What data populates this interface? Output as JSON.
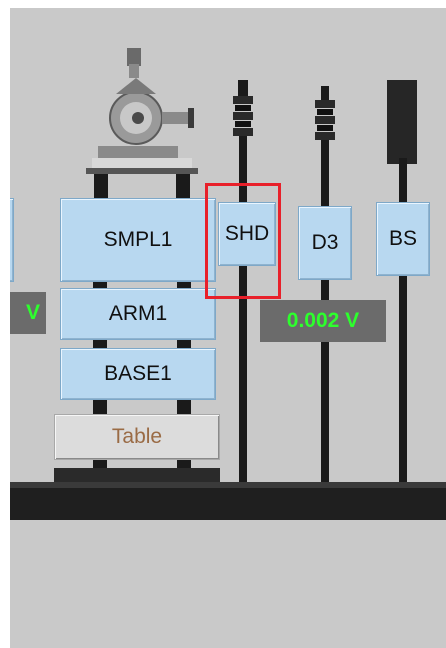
{
  "components": {
    "smpl1": "SMPL1",
    "arm1": "ARM1",
    "base1": "BASE1",
    "table": "Table",
    "shd": "SHD",
    "d3": "D3",
    "bs": "BS"
  },
  "readouts": {
    "left_voltage": "V",
    "d3_voltage": "0.002 V"
  },
  "colors": {
    "panel": "#c9c9c9",
    "button": "#b8d8f0",
    "readout_bg": "#6b6b6b",
    "readout_text": "#2dff2d",
    "highlight": "#e8202a"
  }
}
